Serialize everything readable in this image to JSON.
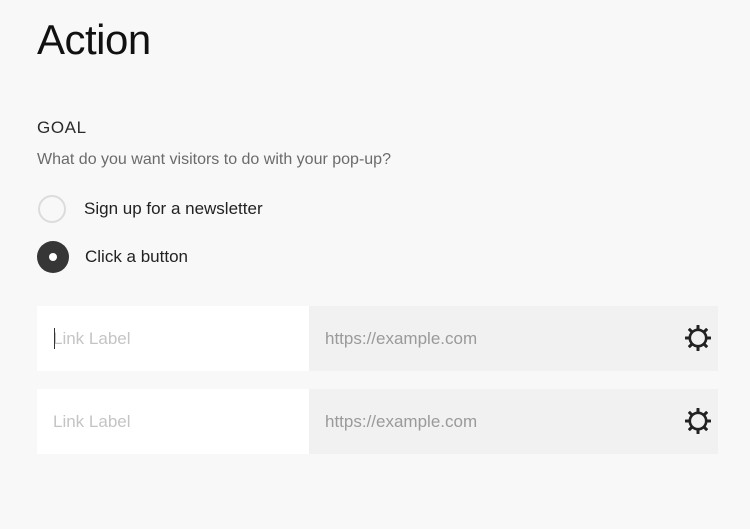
{
  "header": {
    "title": "Action"
  },
  "goal": {
    "label": "GOAL",
    "description": "What do you want visitors to do with your pop-up?",
    "options": [
      {
        "label": "Sign up for a newsletter",
        "selected": false
      },
      {
        "label": "Click a button",
        "selected": true
      }
    ]
  },
  "buttons": [
    {
      "label_value": "",
      "label_placeholder": "Link Label",
      "url_value": "",
      "url_placeholder": "https://example.com",
      "settings_icon": "gear-icon",
      "focused": true
    },
    {
      "label_value": "",
      "label_placeholder": "Link Label",
      "url_value": "",
      "url_placeholder": "https://example.com",
      "settings_icon": "gear-icon",
      "focused": false
    }
  ],
  "colors": {
    "background": "#f8f8f8",
    "radio_selected": "#363636",
    "radio_unselected_border": "#dcdcdc",
    "label_field_bg": "#ffffff",
    "url_field_bg": "#f1f1f1",
    "icon": "#222222"
  }
}
